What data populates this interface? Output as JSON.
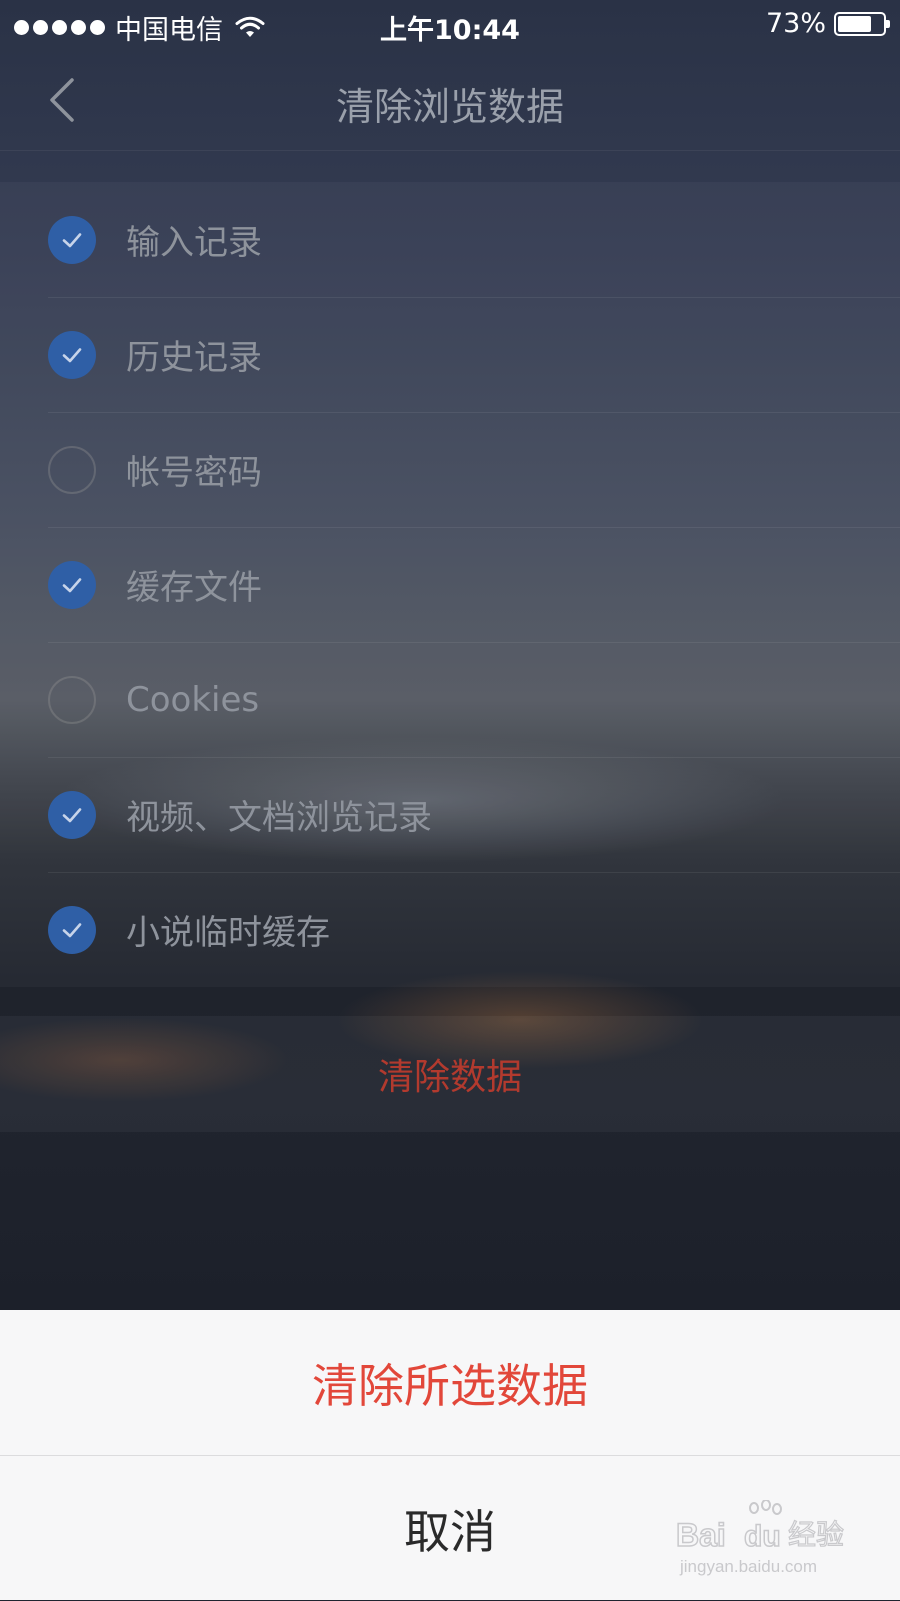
{
  "status_bar": {
    "carrier": "中国电信",
    "time": "上午10:44",
    "battery": "73%"
  },
  "nav": {
    "title": "清除浏览数据"
  },
  "options": [
    {
      "label": "输入记录",
      "checked": true
    },
    {
      "label": "历史记录",
      "checked": true
    },
    {
      "label": "帐号密码",
      "checked": false
    },
    {
      "label": "缓存文件",
      "checked": true
    },
    {
      "label": "Cookies",
      "checked": false
    },
    {
      "label": "视频、文档浏览记录",
      "checked": true
    },
    {
      "label": "小说临时缓存",
      "checked": true
    }
  ],
  "clear_button": {
    "label": "清除数据"
  },
  "action_sheet": {
    "confirm_label": "清除所选数据",
    "cancel_label": "取消"
  },
  "watermark": {
    "brand_latin": "Bai",
    "brand_du": "du",
    "brand_cn": "经验",
    "url": "jingyan.baidu.com"
  },
  "colors": {
    "accent_blue": "#2f5fa6",
    "destructive_red": "#e2473a"
  }
}
